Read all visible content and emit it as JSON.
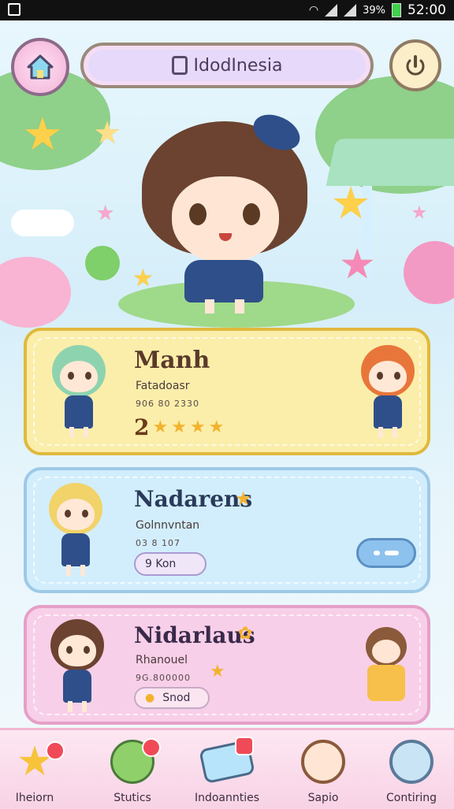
{
  "status_bar": {
    "battery": "39%",
    "time": "52:00"
  },
  "header": {
    "title": "IdodInesia"
  },
  "cards": [
    {
      "name": "Manh",
      "subtitle": "Fatadoasr",
      "code": "906 80 2330",
      "rating_text": "2"
    },
    {
      "name": "Nadarens",
      "subtitle": "Golnnvntan",
      "code": "03 8 107",
      "tag": "9  Kon"
    },
    {
      "name": "Nidarlaus",
      "subtitle": "Rhanouel",
      "code": "9G.800000",
      "tag": "Snod"
    }
  ],
  "nav": [
    {
      "label": "Iheiorn"
    },
    {
      "label": "Stutics"
    },
    {
      "label": "Indoannties"
    },
    {
      "label": "Sapio"
    },
    {
      "label": "Contiring"
    }
  ]
}
